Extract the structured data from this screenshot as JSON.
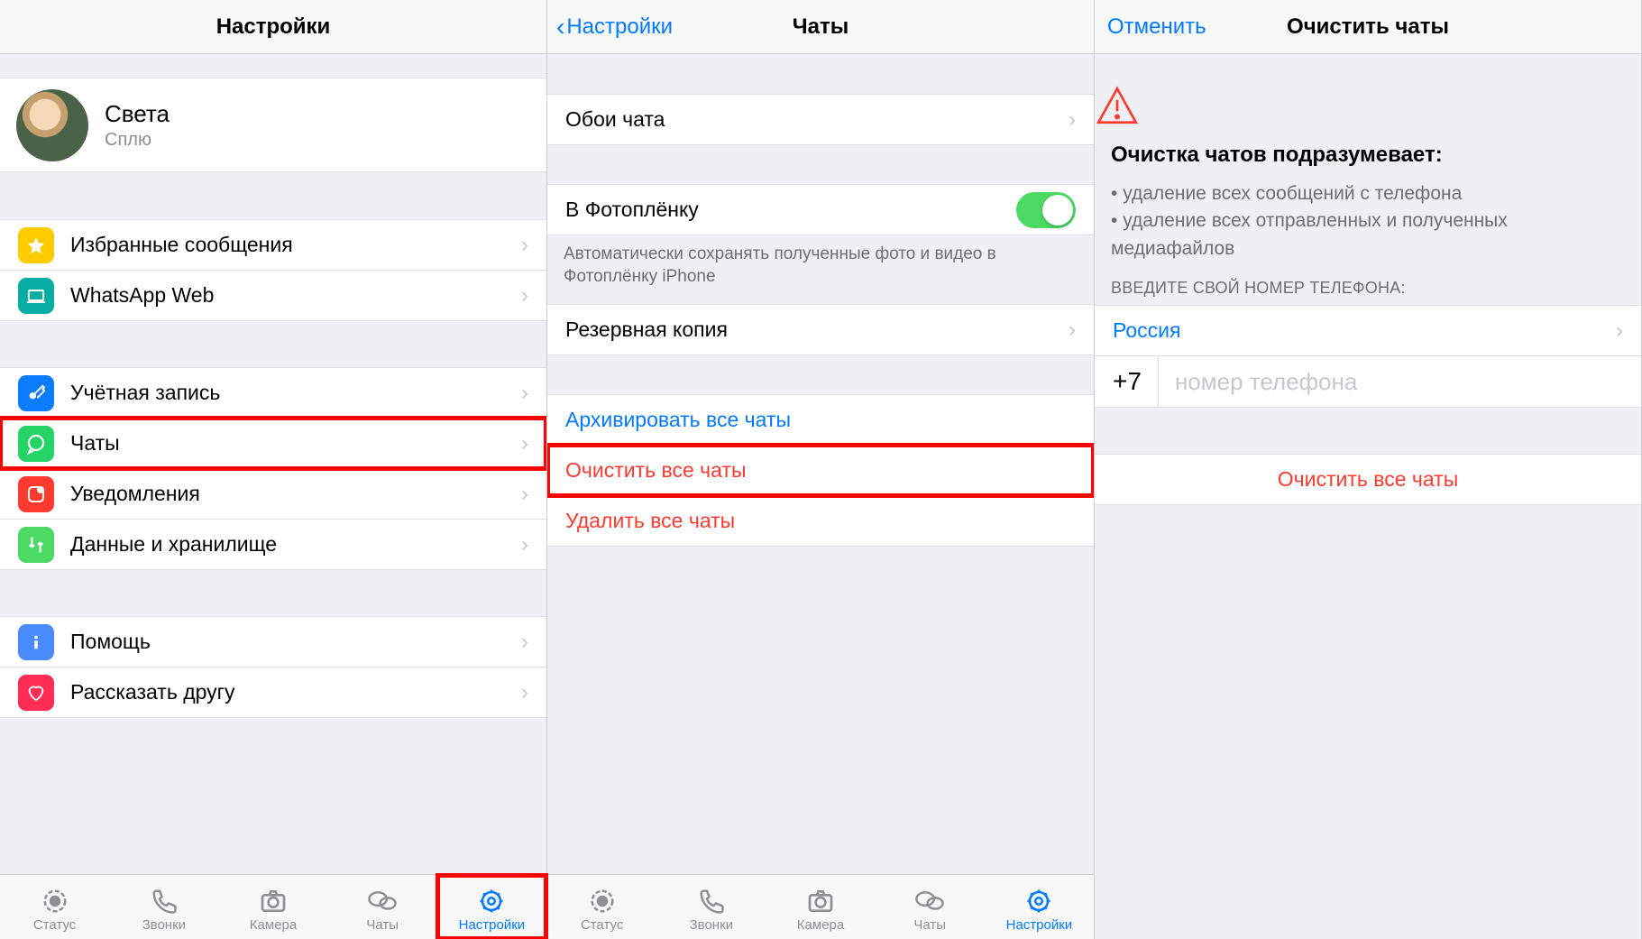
{
  "screen1": {
    "title": "Настройки",
    "profile": {
      "name": "Света",
      "status": "Сплю"
    },
    "starred_label": "Избранные сообщения",
    "web_label": "WhatsApp Web",
    "account_label": "Учётная запись",
    "chats_label": "Чаты",
    "notifications_label": "Уведомления",
    "data_label": "Данные и хранилище",
    "help_label": "Помощь",
    "tell_label": "Рассказать другу"
  },
  "screen2": {
    "back_label": "Настройки",
    "title": "Чаты",
    "wallpaper_label": "Обои чата",
    "camera_roll_label": "В Фотоплёнку",
    "camera_roll_note": "Автоматически сохранять полученные фото и видео в Фотоплёнку iPhone",
    "backup_label": "Резервная копия",
    "archive_label": "Архивировать все чаты",
    "clear_label": "Очистить все чаты",
    "delete_label": "Удалить все чаты"
  },
  "screen3": {
    "cancel_label": "Отменить",
    "title": "Очистить чаты",
    "heading": "Очистка чатов подразумевает:",
    "bullet1": "удаление всех сообщений с телефона",
    "bullet2": "удаление всех отправленных и полученных медиафайлов",
    "phone_section": "ВВЕДИТЕ СВОЙ НОМЕР ТЕЛЕФОНА:",
    "country": "Россия",
    "code": "+7",
    "phone_placeholder": "номер телефона",
    "clear_button": "Очистить все чаты"
  },
  "tabs": {
    "status": "Статус",
    "calls": "Звонки",
    "camera": "Камера",
    "chats": "Чаты",
    "settings": "Настройки"
  }
}
